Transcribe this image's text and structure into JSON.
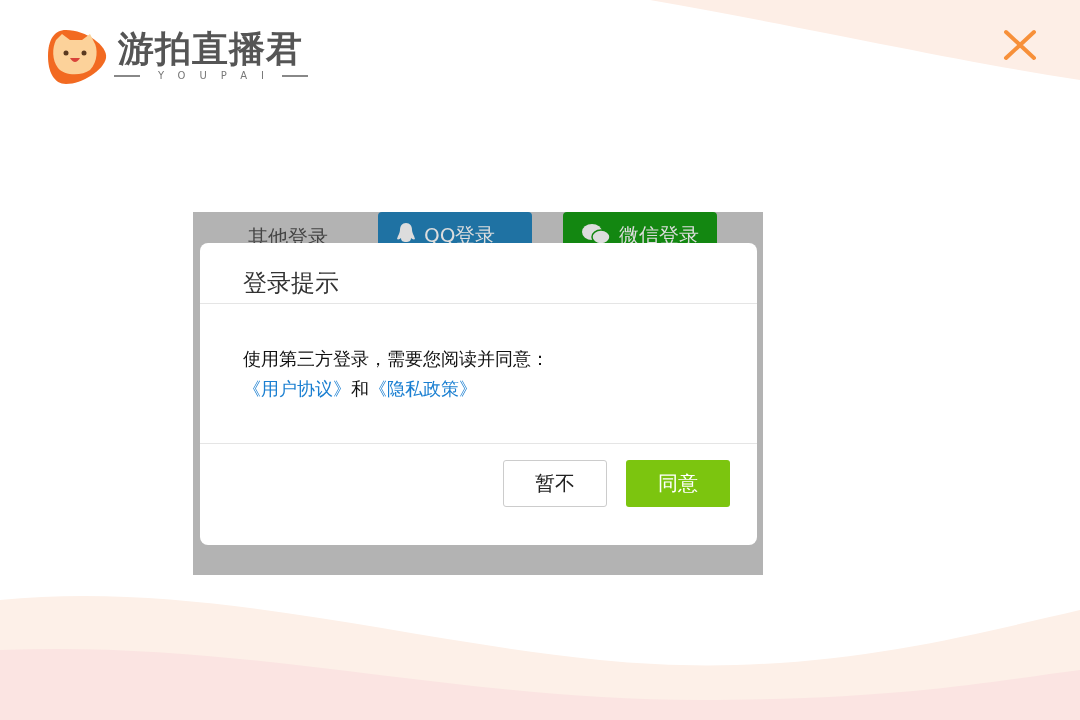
{
  "logo": {
    "name": "游拍直播君",
    "tagline": "YOUPAI"
  },
  "login_panel": {
    "label": "其他登录",
    "buttons": [
      {
        "kind": "qq",
        "label": "QQ登录"
      },
      {
        "kind": "wechat",
        "label": "微信登录"
      }
    ]
  },
  "dialog": {
    "title": "登录提示",
    "message": "使用第三方登录，需要您阅读并同意：",
    "links": [
      "《用户协议》",
      "《隐私政策》"
    ],
    "joiner": "和",
    "buttons": [
      {
        "kind": "secondary",
        "label": "暂不"
      },
      {
        "kind": "primary",
        "label": "同意"
      }
    ]
  }
}
